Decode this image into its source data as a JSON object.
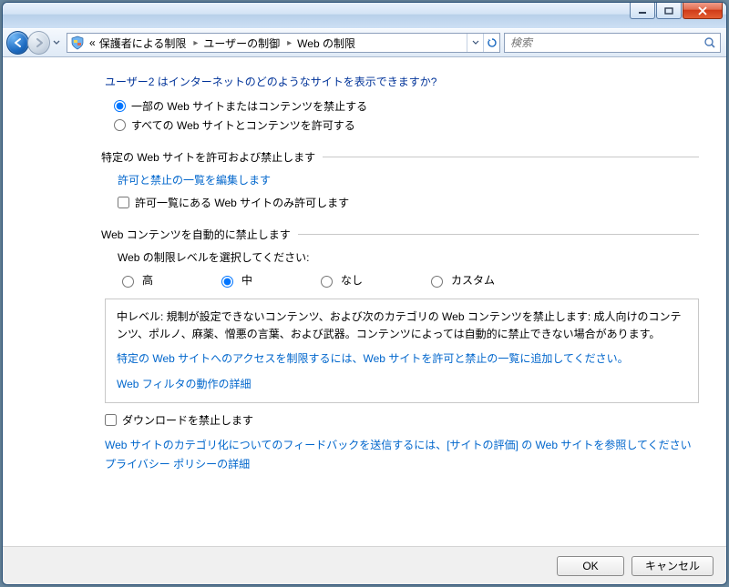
{
  "titlebar": {},
  "nav": {
    "breadcrumbs": [
      "«",
      "保護者による制限",
      "ユーザーの制御",
      "Web の制限"
    ],
    "search_placeholder": "検索"
  },
  "main": {
    "question": "ユーザー2 はインターネットのどのようなサイトを表示できますか?",
    "top_options": {
      "block_some": "一部の Web サイトまたはコンテンツを禁止する",
      "allow_all": "すべての Web サイトとコンテンツを許可する"
    },
    "specific_group": {
      "title": "特定の Web サイトを許可および禁止します",
      "edit_link": "許可と禁止の一覧を編集します",
      "only_allow_checkbox": "許可一覧にある Web サイトのみ許可します"
    },
    "auto_group": {
      "title": "Web コンテンツを自動的に禁止します",
      "level_prompt": "Web の制限レベルを選択してください:",
      "levels": {
        "high": "高",
        "medium": "中",
        "none": "なし",
        "custom": "カスタム"
      },
      "desc_heading": "中レベル: 規制が設定できないコンテンツ、および次のカテゴリの Web コンテンツを禁止します: 成人向けのコンテンツ、ポルノ、麻薬、憎悪の言葉、および武器。コンテンツによっては自動的に禁止できない場合があります。",
      "desc_link1": "特定の Web サイトへのアクセスを制限するには、Web サイトを許可と禁止の一覧に追加してください。",
      "desc_link2": "Web フィルタの動作の詳細"
    },
    "download_checkbox": "ダウンロードを禁止します",
    "feedback_link": "Web サイトのカテゴリ化についてのフィードバックを送信するには、[サイトの評価] の Web サイトを参照してください",
    "privacy_link": "プライバシー ポリシーの詳細"
  },
  "footer": {
    "ok": "OK",
    "cancel": "キャンセル"
  }
}
